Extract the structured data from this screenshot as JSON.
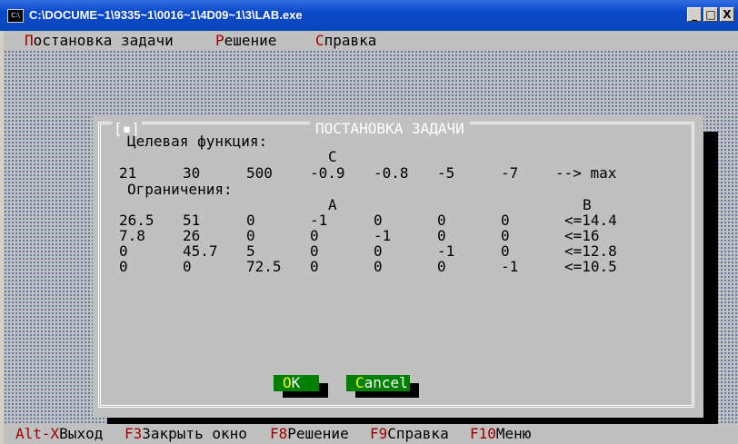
{
  "window": {
    "title": "C:\\DOCUME~1\\9335~1\\0016~1\\4D09~1\\3\\LAB.exe",
    "icon_text": "C:\\",
    "controls": {
      "minimize": "_",
      "maximize": "□",
      "close": "X"
    }
  },
  "menu": [
    {
      "hot": "П",
      "rest": "остановка задачи"
    },
    {
      "hot": "Р",
      "rest": "ешение"
    },
    {
      "hot": "С",
      "rest": "правка"
    }
  ],
  "dialog": {
    "title": "ПОСТАНОВКА ЗАДАЧИ",
    "close_glyph": "[▪]",
    "objective_label": "Целевая функция:",
    "c_header": "C",
    "c_values": [
      "21",
      "30",
      "500",
      "-0.9",
      "-0.8",
      "-5",
      "-7"
    ],
    "objective_suffix": "--> max",
    "constraints_label": "Ограничения:",
    "a_header": "A",
    "b_header": "B",
    "rows": [
      {
        "a": [
          "26.5",
          "51",
          "0",
          "-1",
          "0",
          "0",
          "0"
        ],
        "b": "<=14.4"
      },
      {
        "a": [
          "7.8",
          "26",
          "0",
          "0",
          "-1",
          "0",
          "0"
        ],
        "b": "<=16"
      },
      {
        "a": [
          "0",
          "45.7",
          "5",
          "0",
          "0",
          "-1",
          "0"
        ],
        "b": "<=12.8"
      },
      {
        "a": [
          "0",
          "0",
          "72.5",
          "0",
          "0",
          "0",
          "-1"
        ],
        "b": "<=10.5"
      }
    ],
    "ok": {
      "hot": "O",
      "rest": "K"
    },
    "cancel": {
      "hot": "C",
      "rest": "ancel"
    }
  },
  "status_bar": [
    {
      "key": "Alt-X",
      "label": "Выход"
    },
    {
      "key": "F3",
      "label": "Закрыть окно"
    },
    {
      "key": "F8",
      "label": "Решение"
    },
    {
      "key": "F9",
      "label": "Справка"
    },
    {
      "key": "F10",
      "label": "Меню"
    }
  ],
  "colors": {
    "title_bar": "#0a48c8",
    "console_bg": "#c0c0c0",
    "hotkey": "#a00000",
    "button_bg": "#008000",
    "button_hotkey": "#ffff00",
    "dialog_title": "#ffffff"
  }
}
